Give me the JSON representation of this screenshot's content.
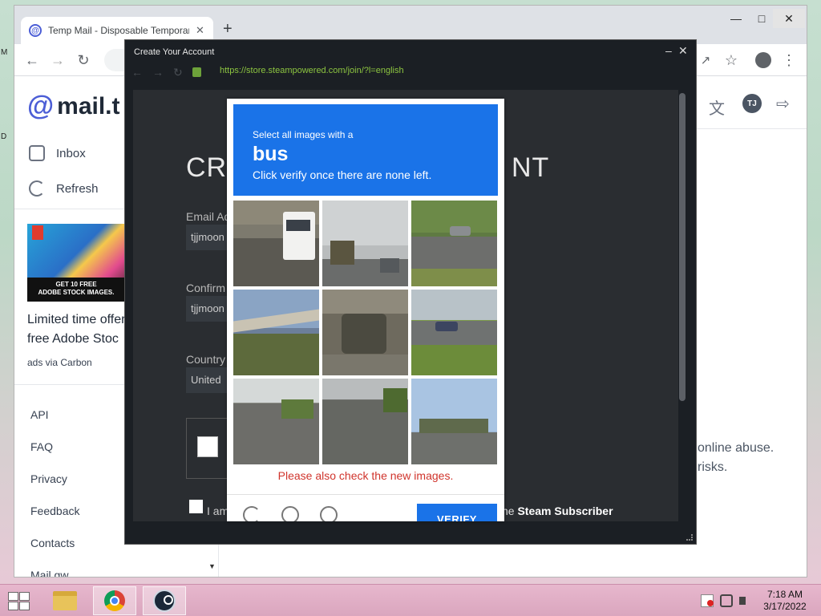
{
  "browser": {
    "tab_title": "Temp Mail - Disposable Temporary",
    "new_tab": "+",
    "tab_close": "✕"
  },
  "mailtm": {
    "logo_text": "mail.t",
    "nav": {
      "inbox": "Inbox",
      "refresh": "Refresh"
    },
    "ad": {
      "caption_line1": "GET 10 FREE",
      "caption_line2": "ADOBE STOCK IMAGES.",
      "text_line1": "Limited time offer",
      "text_line2": "free Adobe Stoc",
      "via": "ads via Carbon"
    },
    "footer_links": [
      "API",
      "FAQ",
      "Privacy",
      "Feedback",
      "Contacts",
      "Mail.gw"
    ],
    "user_initials": "TJ",
    "body_text_1": "online abuse.",
    "body_text_2": "risks."
  },
  "steam": {
    "window_title": "Create Your Account",
    "url": "https://store.steampowered.com/join/?l=english",
    "heading_left": "CRE",
    "heading_right": "NT",
    "email_label": "Email Ad",
    "email_value": "tjjmoon",
    "confirm_label": "Confirm",
    "confirm_value": "tjjmoon",
    "country_label": "Country",
    "country_value": "United",
    "agree_text": "I am",
    "subscriber_prefix": "he",
    "subscriber_bold": "Steam Subscriber"
  },
  "captcha": {
    "instruction": "Select all images with a",
    "target": "bus",
    "hint": "Click verify once there are none left.",
    "error": "Please also check the new images.",
    "verify_label": "VERIFY"
  },
  "taskbar": {
    "time": "7:18 AM",
    "date": "3/17/2022"
  }
}
